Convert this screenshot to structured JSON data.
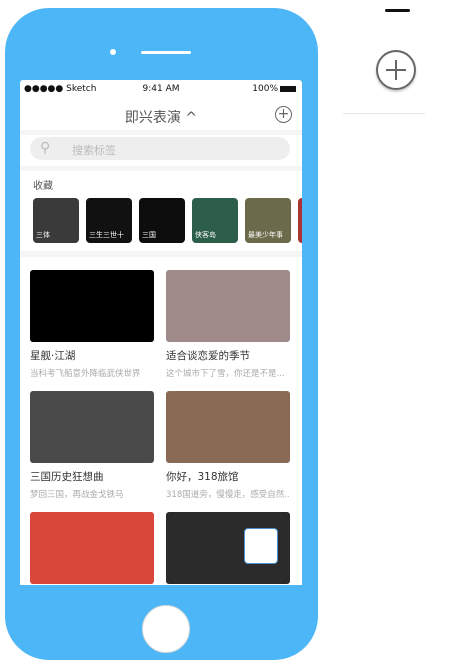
{
  "status": {
    "carrier": "●●●●● Sketch",
    "time": "9:41 AM",
    "battery": "100%"
  },
  "nav": {
    "title": "即兴表演 ^",
    "add": "+"
  },
  "search": {
    "placeholder": "搜索标签",
    "icon": "search-icon"
  },
  "favorites": {
    "label": "收藏",
    "items": [
      {
        "label": "三体",
        "color": "#3a3a3a"
      },
      {
        "label": "三生三世十",
        "color": "#111111"
      },
      {
        "label": "三国",
        "color": "#0d0d0d"
      },
      {
        "label": "侠客岛",
        "color": "#2c5e4a"
      },
      {
        "label": "最美少年事",
        "color": "#6b6a4a"
      },
      {
        "label": "",
        "color": "#a33"
      }
    ]
  },
  "cards": [
    {
      "title": "星舰·江湖",
      "subtitle": "当科考飞船意外降临武侠世界",
      "color": "#000000"
    },
    {
      "title": "适合谈恋爱的季节",
      "subtitle": "这个城市下了雪，你还是不是...",
      "color": "#a08a8a"
    },
    {
      "title": "三国历史狂想曲",
      "subtitle": "梦回三国，再战金戈铁马",
      "color": "#4a4a4a"
    },
    {
      "title": "你好，318旅馆",
      "subtitle": "318国道旁，慢慢走，感受自然...",
      "color": "#8a6a55"
    },
    {
      "title": "",
      "subtitle": "",
      "color": "#d9473a"
    },
    {
      "title": "",
      "subtitle": "",
      "color": "#2a2a2a"
    }
  ]
}
